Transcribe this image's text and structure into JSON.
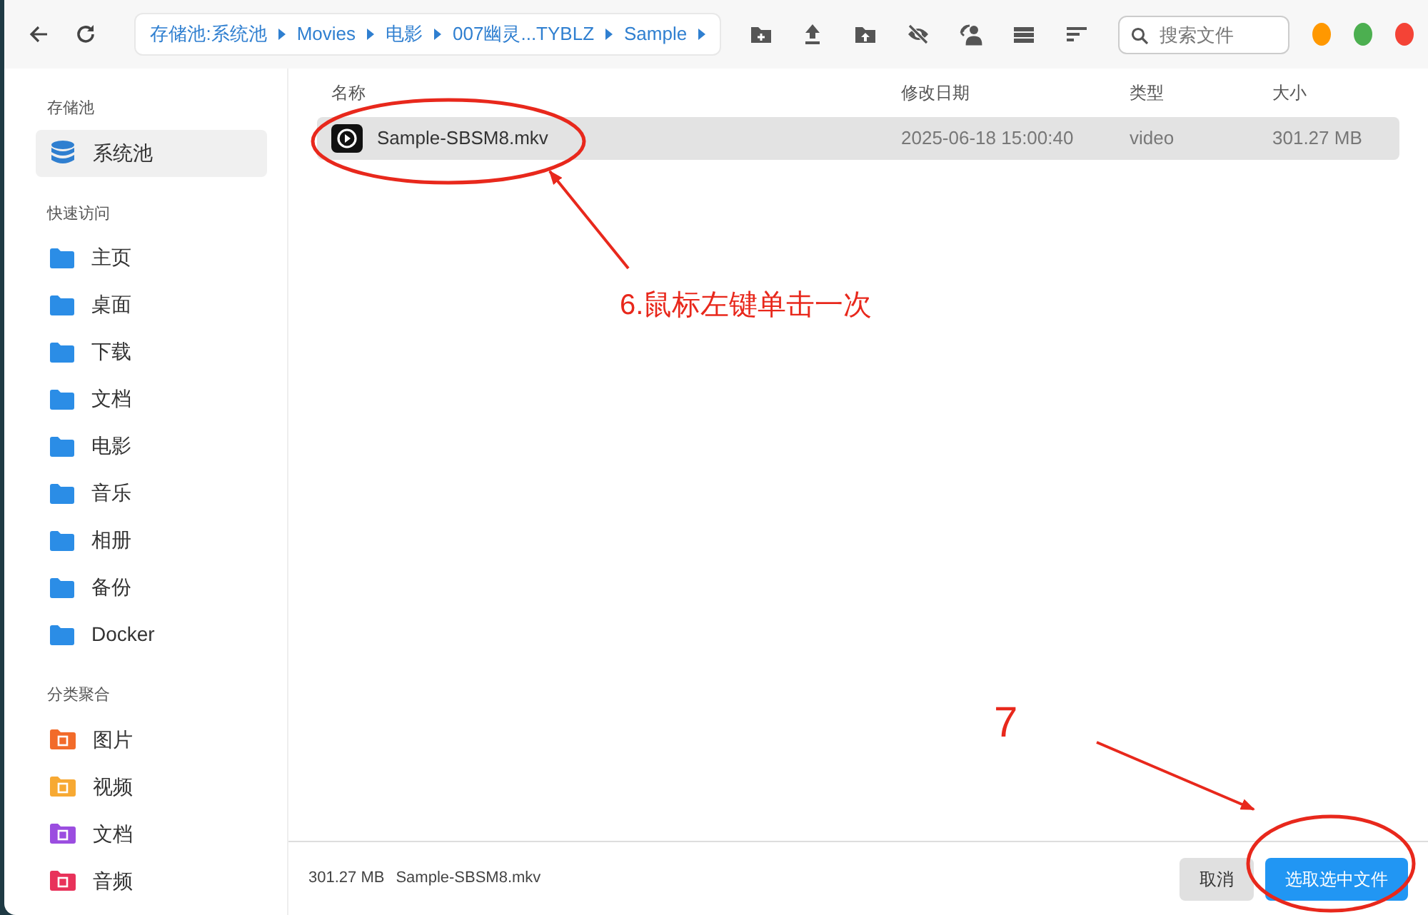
{
  "toolbar": {
    "breadcrumb": [
      {
        "label": "存储池:系统池"
      },
      {
        "label": "Movies"
      },
      {
        "label": "电影"
      },
      {
        "label": "007幽灵...TYBLZ"
      },
      {
        "label": "Sample"
      }
    ],
    "actions": [
      {
        "kind": "new-folder"
      },
      {
        "kind": "upload"
      },
      {
        "kind": "upload-folder"
      },
      {
        "kind": "hide"
      },
      {
        "kind": "share"
      },
      {
        "kind": "list"
      },
      {
        "kind": "sort"
      }
    ],
    "search": {
      "placeholder": "搜索文件"
    },
    "window_controls": [
      {
        "color": "#ff9800"
      },
      {
        "color": "#4caf50"
      },
      {
        "color": "#f44336"
      }
    ]
  },
  "sidebar": {
    "sections": [
      {
        "title": "存储池",
        "items": [
          {
            "label": "系统池",
            "kind": "storage",
            "selected": true
          }
        ]
      },
      {
        "title": "快速访问",
        "items": [
          {
            "label": "主页",
            "kind": "folder",
            "selected": false
          },
          {
            "label": "桌面",
            "kind": "folder",
            "selected": false
          },
          {
            "label": "下载",
            "kind": "folder",
            "selected": false
          },
          {
            "label": "文档",
            "kind": "folder",
            "selected": false
          },
          {
            "label": "电影",
            "kind": "folder",
            "selected": false
          },
          {
            "label": "音乐",
            "kind": "folder",
            "selected": false
          },
          {
            "label": "相册",
            "kind": "folder",
            "selected": false
          },
          {
            "label": "备份",
            "kind": "folder",
            "selected": false
          },
          {
            "label": "Docker",
            "kind": "folder",
            "selected": false
          }
        ]
      },
      {
        "title": "分类聚合",
        "items": [
          {
            "label": "图片",
            "kind": "category",
            "color": "#f26b2a",
            "selected": false
          },
          {
            "label": "视频",
            "kind": "category",
            "color": "#f7a933",
            "selected": false
          },
          {
            "label": "文档",
            "kind": "category",
            "color": "#9b4de0",
            "selected": false
          },
          {
            "label": "音频",
            "kind": "category",
            "color": "#e8325a",
            "selected": false
          }
        ]
      }
    ]
  },
  "table": {
    "columns": [
      "名称",
      "修改日期",
      "类型",
      "大小"
    ],
    "rows": [
      {
        "name": "Sample-SBSM8.mkv",
        "modified": "2025-06-18 15:00:40",
        "type": "video",
        "size": "301.27 MB",
        "selected": true
      }
    ]
  },
  "status_bar": {
    "size": "301.27 MB",
    "file": "Sample-SBSM8.mkv"
  },
  "buttons": [
    {
      "label": "取消",
      "kind": "secondary"
    },
    {
      "label": "选取选中文件",
      "kind": "primary"
    }
  ],
  "annotations": [
    {
      "kind": "ellipse"
    },
    {
      "kind": "arrow"
    },
    {
      "kind": "label",
      "text": "6.鼠标左键单击一次"
    },
    {
      "kind": "label",
      "text": "7"
    },
    {
      "kind": "arrow"
    },
    {
      "kind": "ellipse"
    }
  ]
}
